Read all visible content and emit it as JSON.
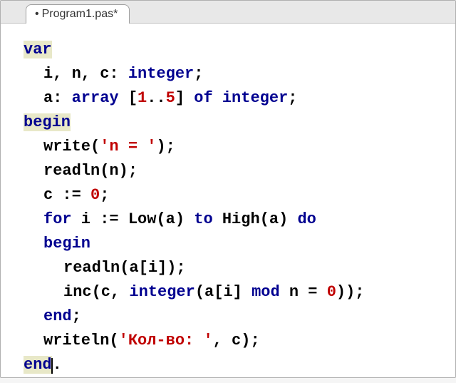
{
  "tab": {
    "modified_indicator": "•",
    "filename": "Program1.pas*"
  },
  "code": {
    "l1_kw": "var",
    "l2_a": "i, n, c: ",
    "l2_type": "integer",
    "l2_b": ";",
    "l3_a": "a: ",
    "l3_kw": "array",
    "l3_b": " [",
    "l3_n1": "1",
    "l3_c": "..",
    "l3_n2": "5",
    "l3_d": "] ",
    "l3_kw2": "of",
    "l3_e": " ",
    "l3_type": "integer",
    "l3_f": ";",
    "l4_kw": "begin",
    "l5_a": "write(",
    "l5_str": "'n = '",
    "l5_b": ");",
    "l6_a": "readln(n);",
    "l7_a": "c := ",
    "l7_n": "0",
    "l7_b": ";",
    "l8_kw1": "for",
    "l8_a": " i := Low(a) ",
    "l8_kw2": "to",
    "l8_b": " High(a) ",
    "l8_kw3": "do",
    "l9_kw": "begin",
    "l10_a": "readln(a[i]);",
    "l11_a": "inc(c, ",
    "l11_type": "integer",
    "l11_b": "(a[i] ",
    "l11_kw": "mod",
    "l11_c": " n = ",
    "l11_n": "0",
    "l11_d": "));",
    "l12_kw": "end",
    "l12_b": ";",
    "l13_a": "writeln(",
    "l13_str": "'Кол-во: '",
    "l13_b": ", c);",
    "l14_kw": "end",
    "l14_b": "."
  }
}
